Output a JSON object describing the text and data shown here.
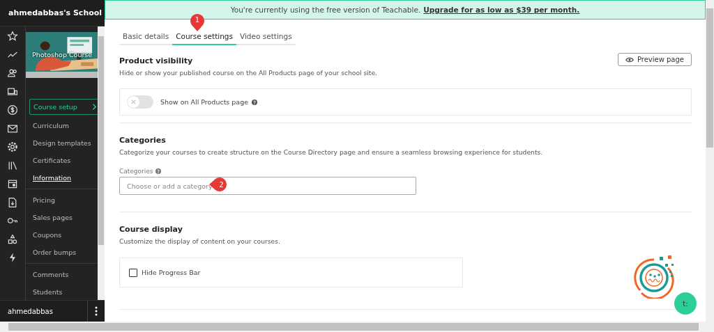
{
  "sidebar": {
    "school_name": "ahmedabbas's School",
    "course_title": "Photoshop Course",
    "section_button": "Course setup",
    "nav_groups": [
      [
        {
          "label": "Curriculum",
          "selected": false
        },
        {
          "label": "Design templates",
          "selected": false
        },
        {
          "label": "Certificates",
          "selected": false
        },
        {
          "label": "Information",
          "selected": true
        }
      ],
      [
        {
          "label": "Pricing",
          "selected": false
        },
        {
          "label": "Sales pages",
          "selected": false
        },
        {
          "label": "Coupons",
          "selected": false
        },
        {
          "label": "Order bumps",
          "selected": false
        }
      ],
      [
        {
          "label": "Comments",
          "selected": false
        },
        {
          "label": "Students",
          "selected": false
        }
      ]
    ],
    "user": "ahmedabbas"
  },
  "banner": {
    "text": "You're currently using the free version of Teachable.",
    "link": "Upgrade for as low as $39 per month."
  },
  "tabs": [
    {
      "label": "Basic details",
      "selected": false
    },
    {
      "label": "Course settings",
      "selected": true
    },
    {
      "label": "Video settings",
      "selected": false
    }
  ],
  "product_visibility": {
    "title": "Product visibility",
    "description": "Hide or show your published course on the All Products page of your school site.",
    "preview_button": "Preview page",
    "toggle": {
      "label": "Show on All Products page",
      "on": false
    }
  },
  "categories": {
    "title": "Categories",
    "description": "Categorize your courses to create structure on the Course Directory page and ensure a seamless browsing experience for students.",
    "field_label": "Categories",
    "placeholder": "Choose or add a category"
  },
  "course_display": {
    "title": "Course display",
    "description": "Customize the display of content on your courses.",
    "checkbox": {
      "label": "Hide Progress Bar",
      "checked": false
    }
  },
  "annotations": [
    {
      "number": "1"
    },
    {
      "number": "2"
    }
  ],
  "chat_button": "t:"
}
